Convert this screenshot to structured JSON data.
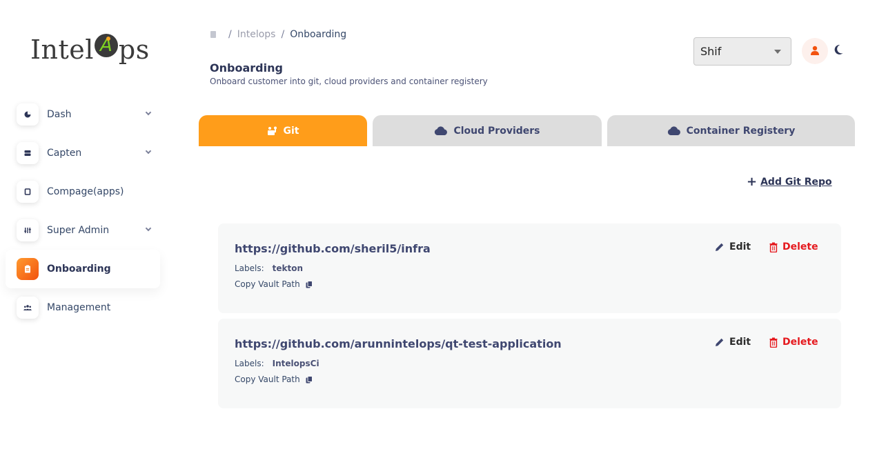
{
  "logo": {
    "prefix": "Intel",
    "badge": "A",
    "suffix": "ps"
  },
  "sidebar": {
    "items": [
      {
        "label": "Dash",
        "icon": "pie-chart-icon",
        "expandable": true
      },
      {
        "label": "Capten",
        "icon": "server-icon",
        "expandable": true
      },
      {
        "label": "Compage(apps)",
        "icon": "tablet-icon",
        "expandable": false
      },
      {
        "label": "Super Admin",
        "icon": "sliders-icon",
        "expandable": true
      },
      {
        "label": "Onboarding",
        "icon": "clipboard-icon",
        "expandable": false,
        "active": true
      },
      {
        "label": "Management",
        "icon": "users-icon",
        "expandable": false
      }
    ]
  },
  "breadcrumb": {
    "parent": "Intelops",
    "current": "Onboarding",
    "sep": "/"
  },
  "header": {
    "title": "Onboarding",
    "subtitle": "Onboard customer into git, cloud providers and container registery"
  },
  "org_select": {
    "value": "Shif"
  },
  "tabs": [
    {
      "label": "Git",
      "icon": "git-icon",
      "active": true
    },
    {
      "label": "Cloud Providers",
      "icon": "cloud-icon",
      "active": false
    },
    {
      "label": "Container Registery",
      "icon": "cloud-icon",
      "active": false
    }
  ],
  "actions": {
    "add_repo": "Add Git Repo"
  },
  "repos": [
    {
      "url": "https://github.com/sheril5/infra",
      "labels_title": "Labels:",
      "labels": "tekton",
      "vault": "Copy Vault Path",
      "edit": "Edit",
      "delete": "Delete"
    },
    {
      "url": "https://github.com/arunnintelops/qt-test-application",
      "labels_title": "Labels:",
      "labels": "IntelopsCi",
      "vault": "Copy Vault Path",
      "edit": "Edit",
      "delete": "Delete"
    }
  ],
  "colors": {
    "accent": "#ff9d1a",
    "danger": "#e5191e",
    "text": "#344767"
  }
}
